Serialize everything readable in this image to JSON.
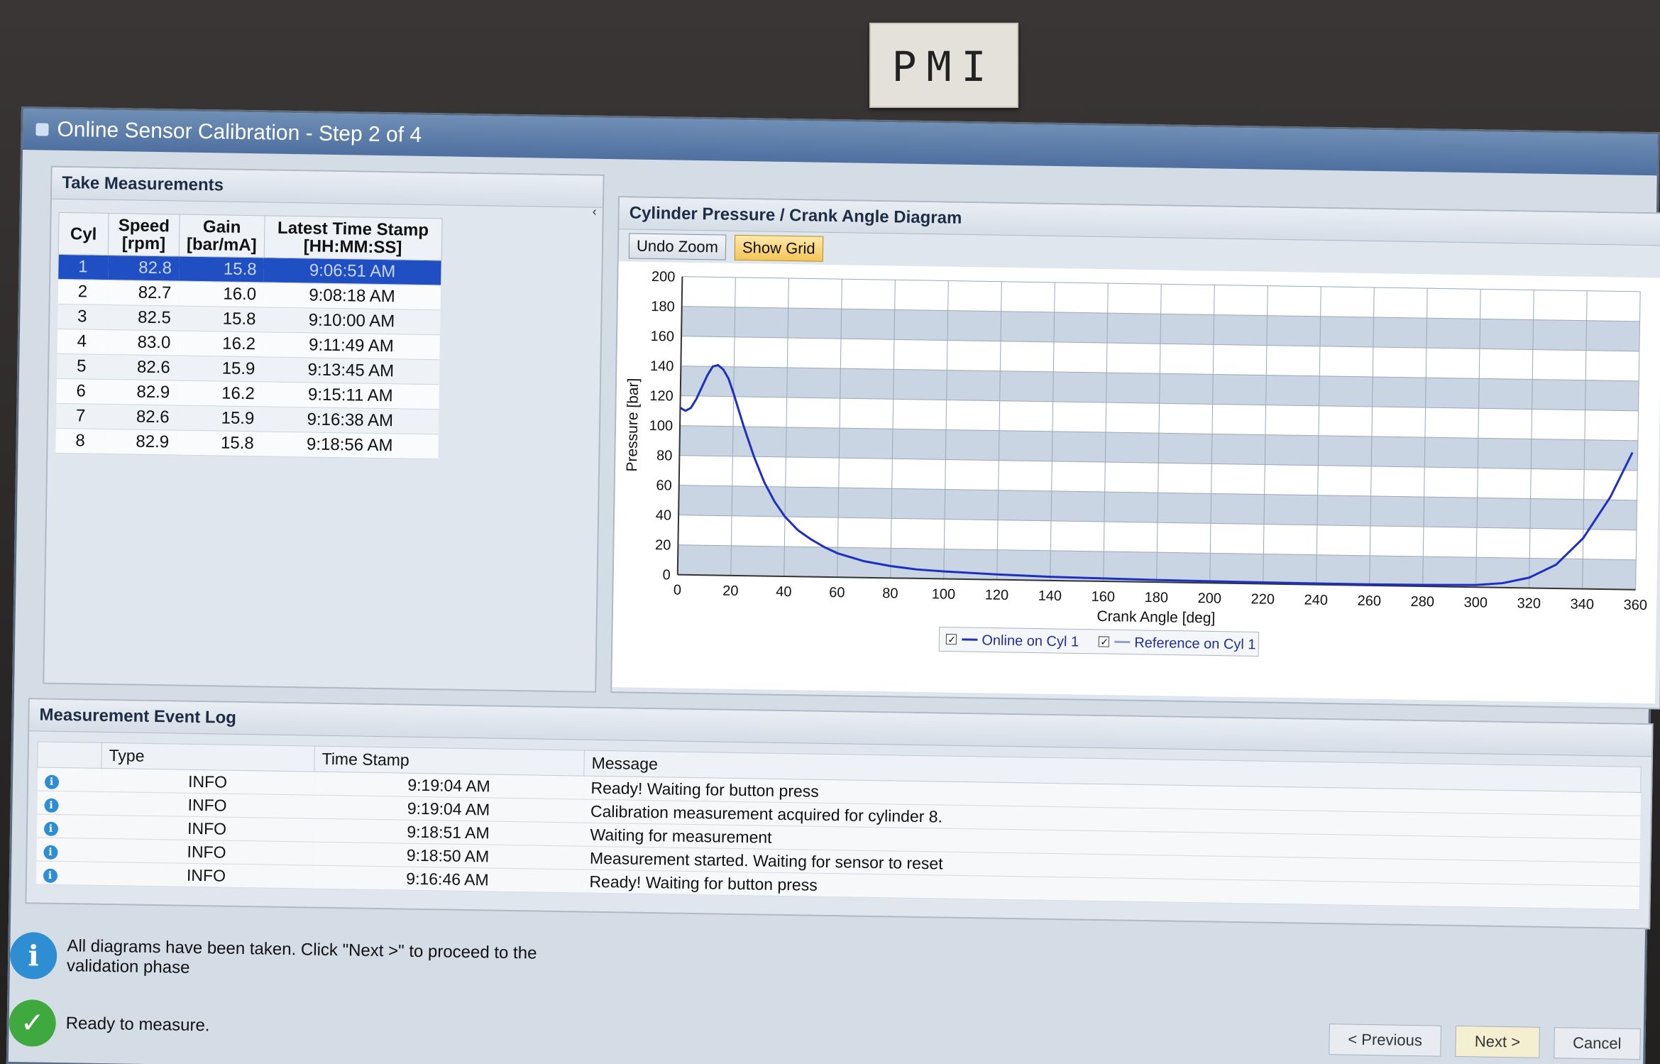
{
  "monitor_label": "PMI",
  "window": {
    "title": "Online Sensor Calibration - Step 2 of 4"
  },
  "measurements": {
    "title": "Take Measurements",
    "collapse_glyph": "‹",
    "columns": [
      "Cyl",
      "Speed\n[rpm]",
      "Gain\n[bar/mA]",
      "Latest Time Stamp\n[HH:MM:SS]"
    ],
    "rows": [
      {
        "cyl": "1",
        "speed": "82.8",
        "gain": "15.8",
        "time": "9:06:51 AM",
        "selected": true
      },
      {
        "cyl": "2",
        "speed": "82.7",
        "gain": "16.0",
        "time": "9:08:18 AM",
        "selected": false
      },
      {
        "cyl": "3",
        "speed": "82.5",
        "gain": "15.8",
        "time": "9:10:00 AM",
        "selected": false
      },
      {
        "cyl": "4",
        "speed": "83.0",
        "gain": "16.2",
        "time": "9:11:49 AM",
        "selected": false
      },
      {
        "cyl": "5",
        "speed": "82.6",
        "gain": "15.9",
        "time": "9:13:45 AM",
        "selected": false
      },
      {
        "cyl": "6",
        "speed": "82.9",
        "gain": "16.2",
        "time": "9:15:11 AM",
        "selected": false
      },
      {
        "cyl": "7",
        "speed": "82.6",
        "gain": "15.9",
        "time": "9:16:38 AM",
        "selected": false
      },
      {
        "cyl": "8",
        "speed": "82.9",
        "gain": "15.8",
        "time": "9:18:56 AM",
        "selected": false
      }
    ]
  },
  "chart_panel": {
    "title": "Cylinder Pressure / Crank Angle Diagram",
    "undo_zoom_label": "Undo Zoom",
    "show_grid_label": "Show Grid"
  },
  "chart_data": {
    "type": "line",
    "title": "Cylinder Pressure / Crank Angle Diagram",
    "xlabel": "Crank Angle [deg]",
    "ylabel": "Pressure [bar]",
    "xlim": [
      0,
      360
    ],
    "ylim": [
      0,
      200
    ],
    "x_ticks": [
      0,
      20,
      40,
      60,
      80,
      100,
      120,
      140,
      160,
      180,
      200,
      220,
      240,
      260,
      280,
      300,
      320,
      340,
      360
    ],
    "y_ticks": [
      0,
      20,
      40,
      60,
      80,
      100,
      120,
      140,
      160,
      180,
      200
    ],
    "grid": true,
    "legend_position": "bottom",
    "series": [
      {
        "name": "Online on Cyl 1",
        "color": "#1f2fbf",
        "x": [
          0,
          2,
          4,
          6,
          8,
          10,
          12,
          14,
          16,
          18,
          20,
          24,
          28,
          32,
          36,
          40,
          45,
          50,
          55,
          60,
          70,
          80,
          90,
          100,
          120,
          140,
          160,
          180,
          200,
          220,
          240,
          260,
          280,
          300,
          310,
          320,
          330,
          340,
          350,
          358
        ],
        "y": [
          112,
          110,
          112,
          118,
          126,
          134,
          140,
          141,
          138,
          132,
          122,
          100,
          80,
          63,
          50,
          40,
          31,
          25,
          20,
          16,
          11,
          8,
          6,
          5,
          3.5,
          2.5,
          2,
          1.5,
          1.2,
          1,
          0.8,
          0.8,
          1,
          1.5,
          3,
          7,
          16,
          34,
          62,
          92
        ]
      },
      {
        "name": "Reference on Cyl 1",
        "color": "#8fa3c7",
        "x": [],
        "y": []
      }
    ]
  },
  "event_log": {
    "title": "Measurement Event Log",
    "columns": [
      "Type",
      "Time Stamp",
      "Message"
    ],
    "rows": [
      {
        "type": "INFO",
        "time": "9:19:04 AM",
        "message": "Ready! Waiting for button press"
      },
      {
        "type": "INFO",
        "time": "9:19:04 AM",
        "message": "Calibration measurement acquired for cylinder 8."
      },
      {
        "type": "INFO",
        "time": "9:18:51 AM",
        "message": "Waiting for measurement"
      },
      {
        "type": "INFO",
        "time": "9:18:50 AM",
        "message": "Measurement started. Waiting for sensor to reset"
      },
      {
        "type": "INFO",
        "time": "9:16:46 AM",
        "message": "Ready! Waiting for button press"
      }
    ]
  },
  "status": {
    "info_message": "All diagrams have been taken. Click \"Next >\" to proceed to the validation phase",
    "ready_message": "Ready to measure."
  },
  "navigation": {
    "previous_label": "< Previous",
    "next_label": "Next >",
    "cancel_label": "Cancel"
  }
}
